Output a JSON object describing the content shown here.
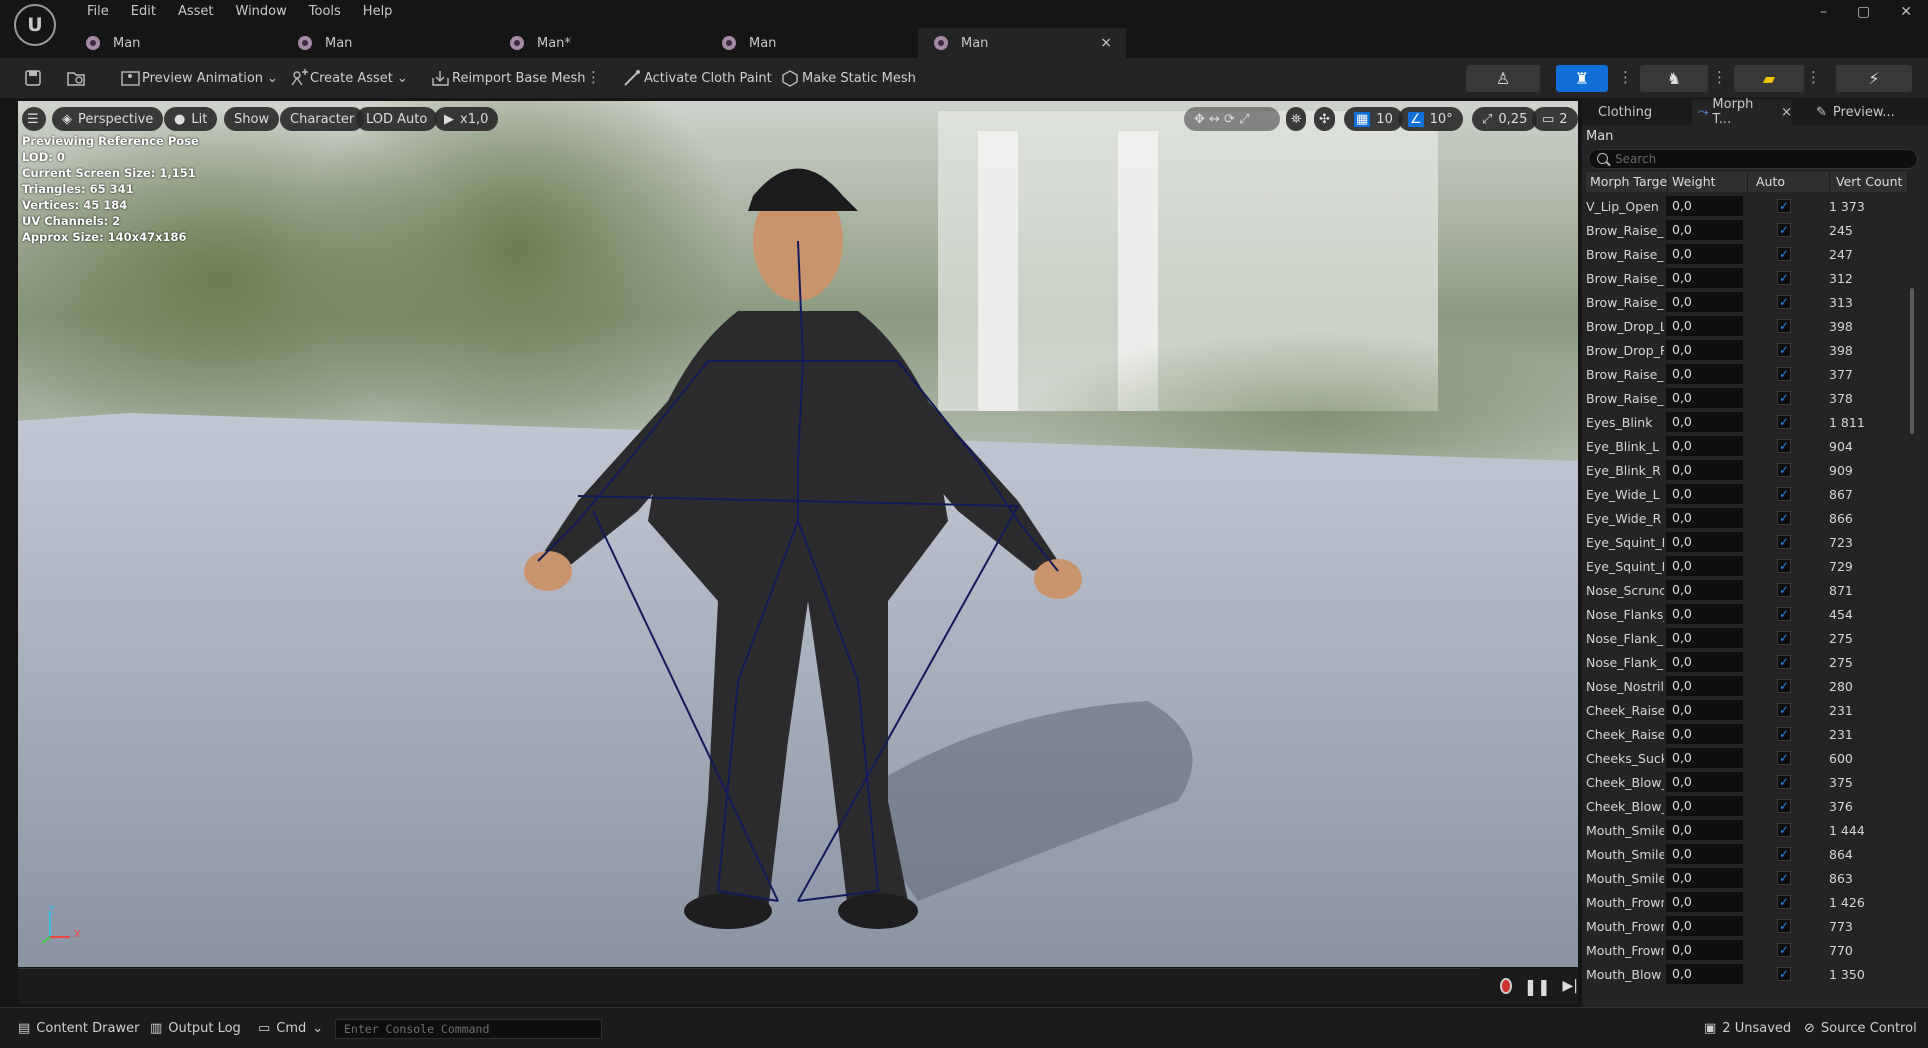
{
  "app": {
    "logo_glyph": "U"
  },
  "menu": [
    "File",
    "Edit",
    "Asset",
    "Window",
    "Tools",
    "Help"
  ],
  "window_controls": [
    "–",
    "▢",
    "✕"
  ],
  "tabs": [
    {
      "label": "Man",
      "active": false
    },
    {
      "label": "Man",
      "active": false
    },
    {
      "label": "Man*",
      "active": false
    },
    {
      "label": "Man",
      "active": false
    },
    {
      "label": "Man",
      "active": true,
      "close": "×"
    }
  ],
  "toolbar": {
    "preview_animation": "Preview Animation",
    "create_asset": "Create Asset",
    "reimport_base_mesh": "Reimport Base Mesh",
    "activate_cloth_paint": "Activate Cloth Paint",
    "make_static_mesh": "Make Static Mesh",
    "accent_color": "#0f6fd6"
  },
  "viewport": {
    "perspective": "Perspective",
    "lit": "Lit",
    "show": "Show",
    "character": "Character",
    "lod_auto": "LOD Auto",
    "play_speed": "x1,0",
    "grid_snap": "10",
    "rot_snap": "10°",
    "scale_snap": "0,25",
    "camera_speed": "2",
    "axis_z": "Z",
    "axis_x": "X",
    "info": [
      "Previewing Reference Pose",
      "LOD: 0",
      "Current Screen Size: 1,151",
      "Triangles: 65 341",
      "Vertices: 45 184",
      "UV Channels: 2",
      "Approx Size: 140x47x186"
    ]
  },
  "right_panel": {
    "tabs": {
      "clothing": "Clothing",
      "morph": "Morph T...",
      "morph_close": "×",
      "preview": "Preview..."
    },
    "title": "Man",
    "search_placeholder": "Search",
    "columns": {
      "name": "Morph Targe",
      "weight": "Weight",
      "auto": "Auto",
      "vert_count": "Vert Count"
    },
    "rows": [
      {
        "name": "V_Lip_Open",
        "weight": "0,0",
        "vc": "1 373"
      },
      {
        "name": "Brow_Raise_In",
        "weight": "0,0",
        "vc": "245"
      },
      {
        "name": "Brow_Raise_In",
        "weight": "0,0",
        "vc": "247"
      },
      {
        "name": "Brow_Raise_Ou",
        "weight": "0,0",
        "vc": "312"
      },
      {
        "name": "Brow_Raise_Ou",
        "weight": "0,0",
        "vc": "313"
      },
      {
        "name": "Brow_Drop_Le",
        "weight": "0,0",
        "vc": "398"
      },
      {
        "name": "Brow_Drop_Ri",
        "weight": "0,0",
        "vc": "398"
      },
      {
        "name": "Brow_Raise_L",
        "weight": "0,0",
        "vc": "377"
      },
      {
        "name": "Brow_Raise_R",
        "weight": "0,0",
        "vc": "378"
      },
      {
        "name": "Eyes_Blink",
        "weight": "0,0",
        "vc": "1 811"
      },
      {
        "name": "Eye_Blink_L",
        "weight": "0,0",
        "vc": "904"
      },
      {
        "name": "Eye_Blink_R",
        "weight": "0,0",
        "vc": "909"
      },
      {
        "name": "Eye_Wide_L",
        "weight": "0,0",
        "vc": "867"
      },
      {
        "name": "Eye_Wide_R",
        "weight": "0,0",
        "vc": "866"
      },
      {
        "name": "Eye_Squint_L",
        "weight": "0,0",
        "vc": "723"
      },
      {
        "name": "Eye_Squint_R",
        "weight": "0,0",
        "vc": "729"
      },
      {
        "name": "Nose_Scrunch",
        "weight": "0,0",
        "vc": "871"
      },
      {
        "name": "Nose_Flanks_",
        "weight": "0,0",
        "vc": "454"
      },
      {
        "name": "Nose_Flank_R",
        "weight": "0,0",
        "vc": "275"
      },
      {
        "name": "Nose_Flank_R",
        "weight": "0,0",
        "vc": "275"
      },
      {
        "name": "Nose_Nostrils",
        "weight": "0,0",
        "vc": "280"
      },
      {
        "name": "Cheek_Raise_",
        "weight": "0,0",
        "vc": "231"
      },
      {
        "name": "Cheek_Raise_",
        "weight": "0,0",
        "vc": "231"
      },
      {
        "name": "Cheeks_Suck",
        "weight": "0,0",
        "vc": "600"
      },
      {
        "name": "Cheek_Blow_L",
        "weight": "0,0",
        "vc": "375"
      },
      {
        "name": "Cheek_Blow_R",
        "weight": "0,0",
        "vc": "376"
      },
      {
        "name": "Mouth_Smile",
        "weight": "0,0",
        "vc": "1 444"
      },
      {
        "name": "Mouth_Smile_",
        "weight": "0,0",
        "vc": "864"
      },
      {
        "name": "Mouth_Smile_",
        "weight": "0,0",
        "vc": "863"
      },
      {
        "name": "Mouth_Frown",
        "weight": "0,0",
        "vc": "1 426"
      },
      {
        "name": "Mouth_Frown_",
        "weight": "0,0",
        "vc": "773"
      },
      {
        "name": "Mouth_Frown_",
        "weight": "0,0",
        "vc": "770"
      },
      {
        "name": "Mouth_Blow",
        "weight": "0,0",
        "vc": "1 350"
      }
    ]
  },
  "bottom_bar": {
    "content_drawer": "Content Drawer",
    "output_log": "Output Log",
    "cmd": "Cmd",
    "console_placeholder": "Enter Console Command",
    "unsaved": "2 Unsaved",
    "source_control": "Source Control"
  }
}
